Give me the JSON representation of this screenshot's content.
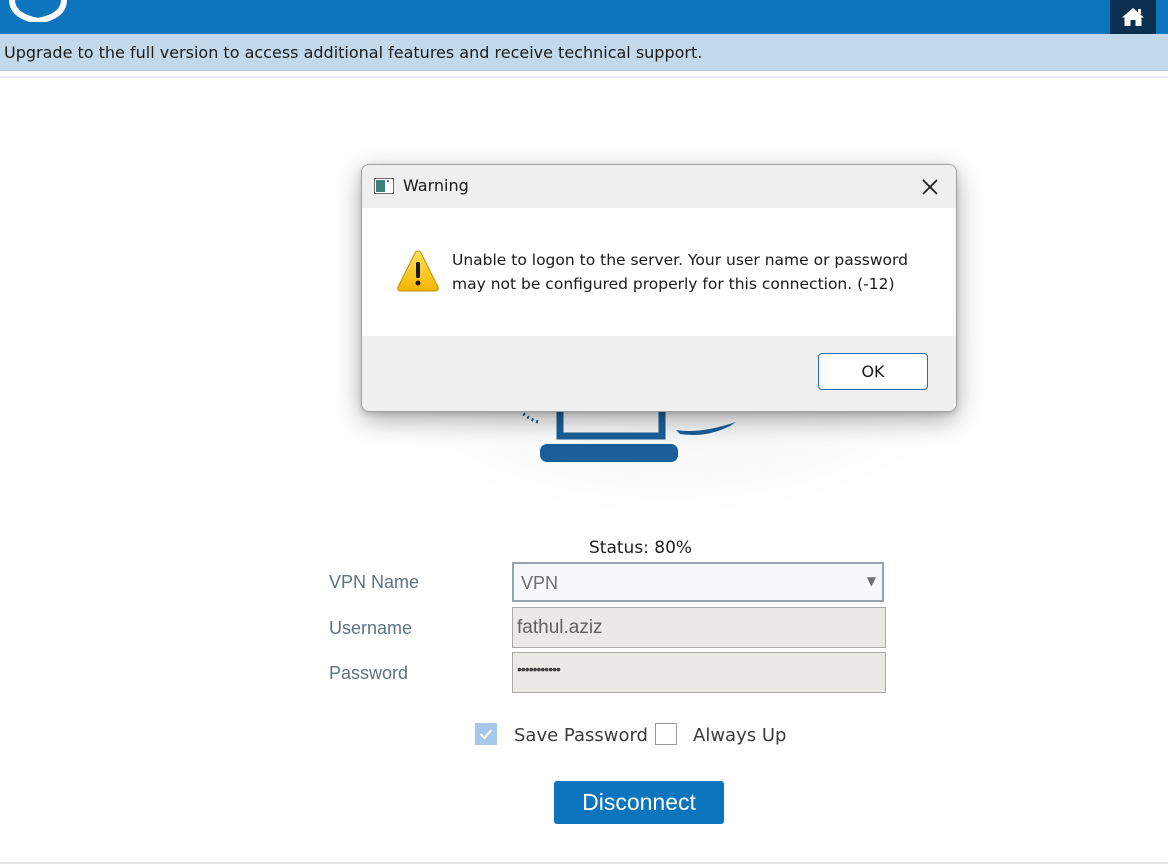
{
  "banner": {
    "text": "Upgrade to the full version to access additional features and receive technical support."
  },
  "header": {
    "logo_icon": "shield-icon",
    "home_icon": "home-icon",
    "brand_color": "#0d75bd"
  },
  "form": {
    "status": "Status: 80%",
    "vpn_name_label": "VPN Name",
    "vpn_name_value": "VPN",
    "username_label": "Username",
    "username_value": "fathul.aziz",
    "password_label": "Password",
    "password_value": "•••••••••••",
    "save_password_label": "Save Password",
    "save_password_checked": true,
    "always_up_label": "Always Up",
    "always_up_checked": false,
    "disconnect_label": "Disconnect"
  },
  "dialog": {
    "title": "Warning",
    "message_line1": "Unable to logon to the server. Your user name or password",
    "message_line2": "may not be configured properly for this connection. (-12)",
    "ok_label": "OK",
    "icon": "warning-icon"
  }
}
